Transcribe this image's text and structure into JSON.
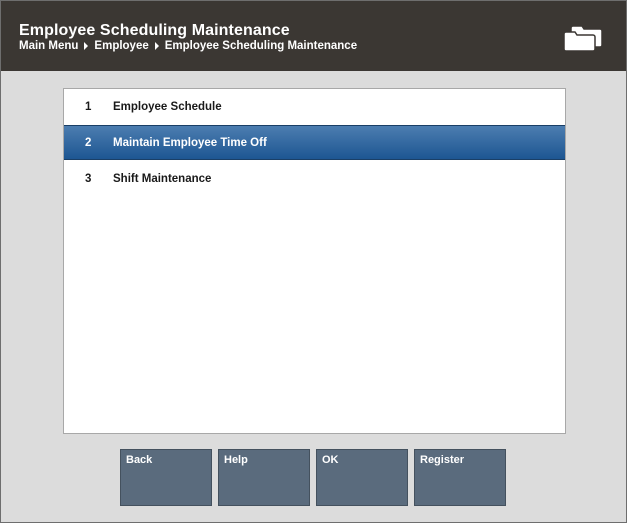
{
  "header": {
    "title": "Employee Scheduling Maintenance",
    "breadcrumb": [
      "Main Menu",
      "Employee",
      "Employee Scheduling Maintenance"
    ]
  },
  "menu": {
    "items": [
      {
        "number": "1",
        "label": "Employee Schedule",
        "selected": false
      },
      {
        "number": "2",
        "label": "Maintain Employee Time Off",
        "selected": true
      },
      {
        "number": "3",
        "label": "Shift Maintenance",
        "selected": false
      }
    ]
  },
  "buttons": {
    "back": "Back",
    "help": "Help",
    "ok": "OK",
    "register": "Register"
  },
  "colors": {
    "header_bg": "#3b3733",
    "selected_row": "#2a62a0",
    "button_bg": "#5a6b7d",
    "window_bg": "#dcdcdc"
  },
  "icons": {
    "header_right": "folders-icon"
  }
}
